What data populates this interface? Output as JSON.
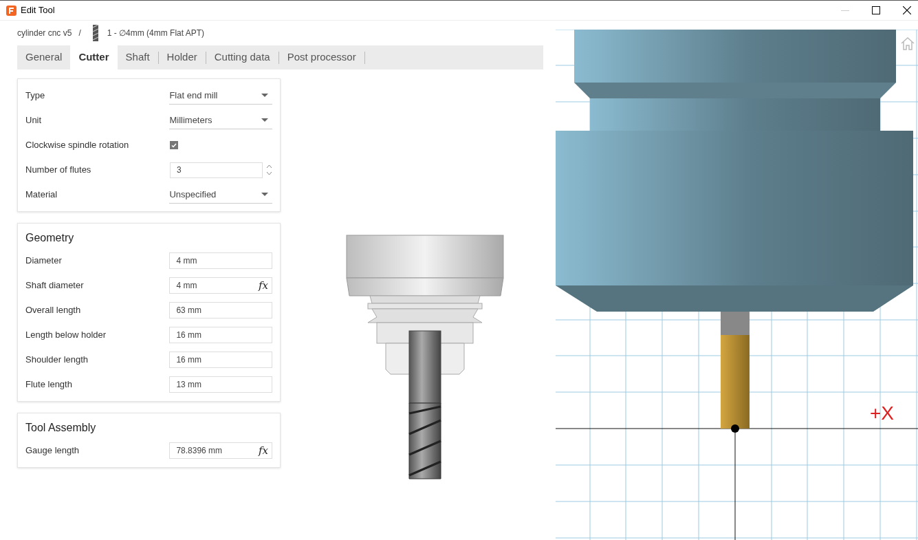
{
  "window": {
    "title": "Edit Tool"
  },
  "breadcrumb": {
    "document": "cylinder cnc v5",
    "separator": "/",
    "tool": "1 - ∅4mm (4mm Flat APT)"
  },
  "tabs": [
    {
      "label": "General",
      "selected": false
    },
    {
      "label": "Cutter",
      "selected": true
    },
    {
      "label": "Shaft",
      "selected": false
    },
    {
      "label": "Holder",
      "selected": false
    },
    {
      "label": "Cutting data",
      "selected": false
    },
    {
      "label": "Post processor",
      "selected": false
    }
  ],
  "cutter": [
    {
      "kind": "dropdown",
      "label": "Type",
      "value": "Flat end mill"
    },
    {
      "kind": "dropdown",
      "label": "Unit",
      "value": "Millimeters"
    },
    {
      "kind": "checkbox",
      "label": "Clockwise spindle rotation",
      "checked": true
    },
    {
      "kind": "spinner",
      "label": "Number of flutes",
      "value": "3"
    },
    {
      "kind": "dropdown",
      "label": "Material",
      "value": "Unspecified"
    }
  ],
  "sections": [
    {
      "title": "Geometry",
      "fields": [
        {
          "label": "Diameter",
          "value": "4 mm"
        },
        {
          "label": "Shaft diameter",
          "value": "4 mm",
          "formula": "fx"
        },
        {
          "label": "Overall length",
          "value": "63 mm"
        },
        {
          "label": "Length below holder",
          "value": "16 mm"
        },
        {
          "label": "Shoulder length",
          "value": "16 mm"
        },
        {
          "label": "Flute length",
          "value": "13 mm"
        }
      ]
    },
    {
      "title": "Tool Assembly",
      "fields": [
        {
          "label": "Gauge length",
          "value": "78.8396 mm",
          "formula": "fx"
        }
      ]
    }
  ],
  "viewport": {
    "axis_label": "+X"
  }
}
